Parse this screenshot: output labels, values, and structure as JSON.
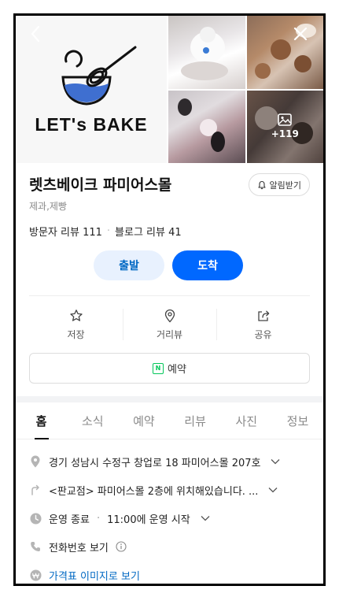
{
  "photos": {
    "logo_text": "LET's BAKE",
    "more_count": "+119"
  },
  "place": {
    "name": "렛츠베이크 파미어스몰",
    "category": "제과,제빵",
    "notify_label": "알림받기",
    "visitor_reviews": "방문자 리뷰 111",
    "blog_reviews": "블로그 리뷰 41"
  },
  "buttons": {
    "depart": "출발",
    "arrive": "도착"
  },
  "actions": {
    "save": "저장",
    "streetview": "거리뷰",
    "share": "공유"
  },
  "reserve_label": "예약",
  "tabs": [
    "홈",
    "소식",
    "예약",
    "리뷰",
    "사진",
    "정보"
  ],
  "info": {
    "address": "경기 성남시 수정구 창업로 18 파미어스몰 207호",
    "directions": "<판교점> 파미어스몰 2층에 위치해있습니다. ...",
    "hours_status": "운영 종료",
    "hours_detail": "11:00에 운영 시작",
    "phone": "전화번호 보기",
    "price": "가격표 이미지로 보기"
  },
  "colors": {
    "accent": "#0068ff",
    "depart_bg": "#e8f1fe",
    "link": "#0068c3",
    "naver_green": "#03c75a"
  }
}
